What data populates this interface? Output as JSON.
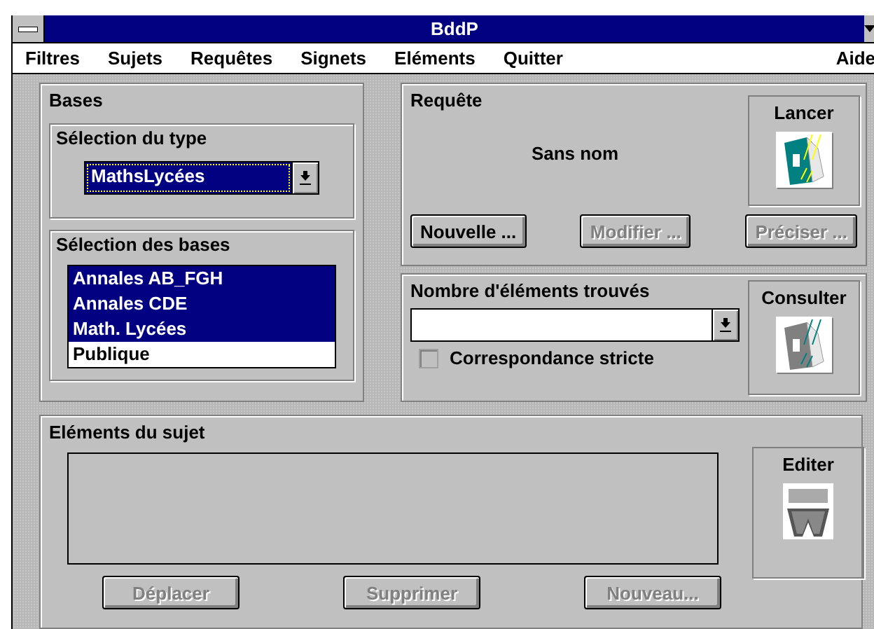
{
  "window": {
    "title": "BddP"
  },
  "menu": [
    {
      "label": "Filtres"
    },
    {
      "label": "Sujets"
    },
    {
      "label": "Requêtes"
    },
    {
      "label": "Signets"
    },
    {
      "label": "Eléments"
    },
    {
      "label": "Quitter"
    },
    {
      "label": "Aide"
    }
  ],
  "bases": {
    "title": "Bases",
    "type_group": {
      "title": "Sélection du type",
      "value": "MathsLycées"
    },
    "bases_group": {
      "title": "Sélection des bases",
      "items": [
        {
          "label": "Annales AB_FGH",
          "selected": true
        },
        {
          "label": "Annales CDE",
          "selected": true
        },
        {
          "label": "Math. Lycées",
          "selected": true
        },
        {
          "label": "Publique",
          "selected": false
        }
      ]
    }
  },
  "requete": {
    "title": "Requête",
    "name": "Sans nom",
    "launch": {
      "label": "Lancer"
    },
    "buttons": [
      {
        "label": "Nouvelle ...",
        "disabled": false
      },
      {
        "label": "Modifier ...",
        "disabled": true
      },
      {
        "label": "Préciser ...",
        "disabled": true
      }
    ]
  },
  "found": {
    "title": "Nombre d'éléments trouvés",
    "strict": {
      "label": "Correspondance stricte",
      "checked": false
    },
    "consult": {
      "label": "Consulter"
    }
  },
  "elements": {
    "title": "Eléments du sujet",
    "edit": {
      "label": "Editer"
    },
    "buttons": [
      {
        "label": "Déplacer",
        "disabled": true
      },
      {
        "label": "Supprimer",
        "disabled": true
      },
      {
        "label": "Nouveau...",
        "disabled": true
      }
    ]
  }
}
